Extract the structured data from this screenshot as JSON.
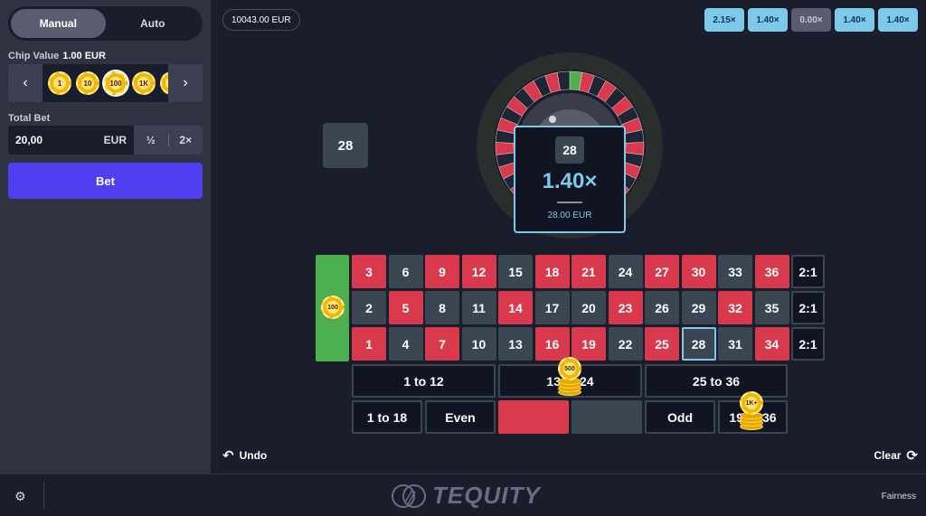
{
  "sidebar": {
    "modes": [
      "Manual",
      "Auto"
    ],
    "chip_value_label": "Chip Value",
    "chip_value": "1.00 EUR",
    "chips": [
      "1",
      "10",
      "100",
      "1K",
      ""
    ],
    "total_bet_label": "Total Bet",
    "total_bet_value": "20,00",
    "total_bet_currency": "EUR",
    "half_label": "½",
    "double_label": "2×",
    "bet_label": "Bet"
  },
  "balance": "10043.00 EUR",
  "history": [
    "2.15×",
    "1.40×",
    "0.00×",
    "1.40×",
    "1.40×"
  ],
  "last_number": "28",
  "result": {
    "number": "28",
    "multiplier": "1.40×",
    "win": "28.00 EUR"
  },
  "board": {
    "rows": [
      [
        {
          "n": "3",
          "c": "red"
        },
        {
          "n": "6",
          "c": "black"
        },
        {
          "n": "9",
          "c": "red"
        },
        {
          "n": "12",
          "c": "red"
        },
        {
          "n": "15",
          "c": "black"
        },
        {
          "n": "18",
          "c": "red"
        },
        {
          "n": "21",
          "c": "red"
        },
        {
          "n": "24",
          "c": "black"
        },
        {
          "n": "27",
          "c": "red"
        },
        {
          "n": "30",
          "c": "red"
        },
        {
          "n": "33",
          "c": "black"
        },
        {
          "n": "36",
          "c": "red"
        },
        {
          "n": "2:1",
          "c": "col"
        }
      ],
      [
        {
          "n": "2",
          "c": "black"
        },
        {
          "n": "5",
          "c": "red"
        },
        {
          "n": "8",
          "c": "black"
        },
        {
          "n": "11",
          "c": "black"
        },
        {
          "n": "14",
          "c": "red"
        },
        {
          "n": "17",
          "c": "black"
        },
        {
          "n": "20",
          "c": "black"
        },
        {
          "n": "23",
          "c": "red"
        },
        {
          "n": "26",
          "c": "black"
        },
        {
          "n": "29",
          "c": "black"
        },
        {
          "n": "32",
          "c": "red"
        },
        {
          "n": "35",
          "c": "black"
        },
        {
          "n": "2:1",
          "c": "col"
        }
      ],
      [
        {
          "n": "1",
          "c": "red"
        },
        {
          "n": "4",
          "c": "black"
        },
        {
          "n": "7",
          "c": "red"
        },
        {
          "n": "10",
          "c": "black"
        },
        {
          "n": "13",
          "c": "black"
        },
        {
          "n": "16",
          "c": "red"
        },
        {
          "n": "19",
          "c": "red"
        },
        {
          "n": "22",
          "c": "black"
        },
        {
          "n": "25",
          "c": "red"
        },
        {
          "n": "28",
          "c": "black"
        },
        {
          "n": "31",
          "c": "black"
        },
        {
          "n": "34",
          "c": "red"
        },
        {
          "n": "2:1",
          "c": "col"
        }
      ]
    ],
    "highlighted": "28",
    "dozens": [
      "1 to 12",
      "13 to 24",
      "25 to 36"
    ],
    "evens": [
      "1 to 18",
      "Even",
      "",
      "",
      "Odd",
      "19 to 36"
    ],
    "chips": {
      "zero": "100",
      "dozen2": "500",
      "high": "1K+"
    }
  },
  "actions": {
    "undo": "Undo",
    "clear": "Clear"
  },
  "footer": {
    "brand": "TEQUITY",
    "fairness": "Fairness"
  },
  "colors": {
    "red": "#d9394d",
    "black": "#3a4752",
    "green": "#4caf50",
    "accent": "#7cc9ec",
    "bet": "#4f3ff0"
  }
}
